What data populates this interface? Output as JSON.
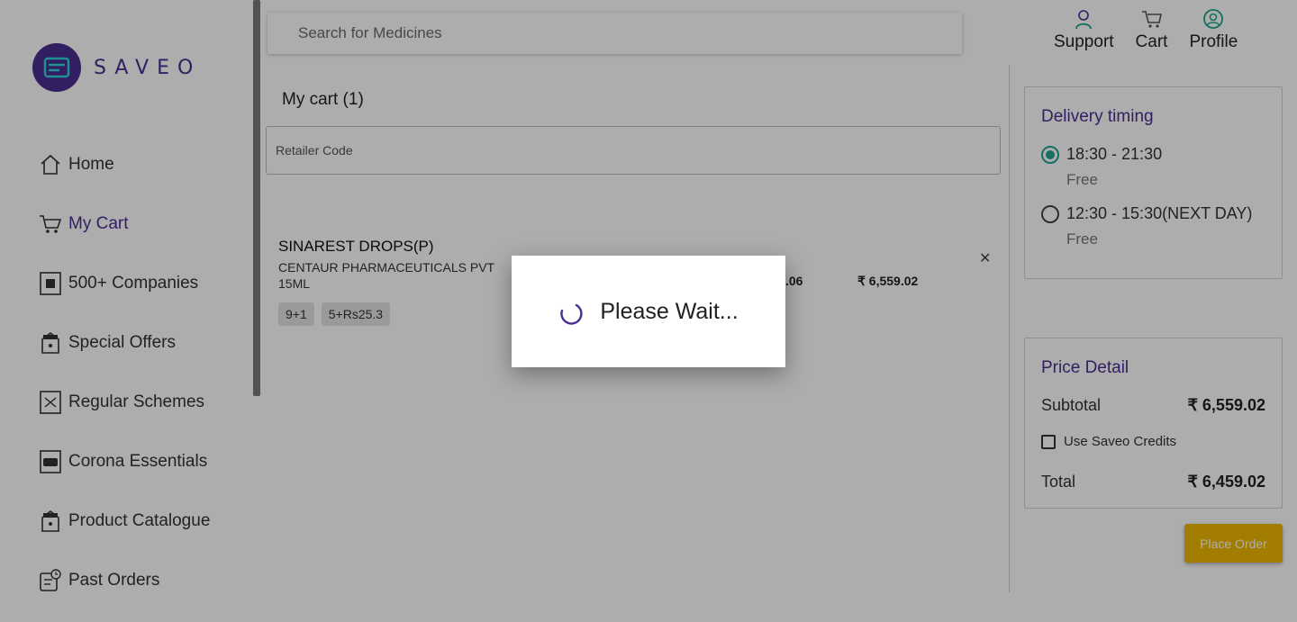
{
  "brand": {
    "name": "SAVEO",
    "color": "#4a2e8f"
  },
  "sidebar": {
    "items": [
      {
        "label": "Home",
        "icon": "home-icon"
      },
      {
        "label": "My Cart",
        "icon": "cart-icon",
        "active": true
      },
      {
        "label": "500+ Companies",
        "icon": "companies-icon"
      },
      {
        "label": "Special Offers",
        "icon": "offers-tag-icon"
      },
      {
        "label": "Regular Schemes",
        "icon": "schemes-icon"
      },
      {
        "label": "Corona Essentials",
        "icon": "mask-icon"
      },
      {
        "label": "Product Catalogue",
        "icon": "catalogue-tag-icon"
      },
      {
        "label": "Past Orders",
        "icon": "past-orders-icon"
      }
    ]
  },
  "search": {
    "placeholder": "Search for Medicines"
  },
  "header_actions": [
    {
      "label": "Support",
      "icon": "support-agent-icon"
    },
    {
      "label": "Cart",
      "icon": "cart-icon"
    },
    {
      "label": "Profile",
      "icon": "profile-icon"
    }
  ],
  "cart": {
    "title": "My cart (1)",
    "retailer_placeholder": "Retailer Code",
    "items": [
      {
        "name": "SINAREST DROPS(P)",
        "manufacturer": "CENTAUR PHARMACEUTICALS PVT",
        "pack": "15ML",
        "schemes": [
          "9+1",
          "5+Rs25.3"
        ],
        "price_partial": ".06",
        "total": "₹ 6,559.02"
      }
    ]
  },
  "delivery": {
    "title": "Delivery timing",
    "slots": [
      {
        "time": "18:30 - 21:30",
        "fee": "Free",
        "selected": true
      },
      {
        "time": "12:30 - 15:30(NEXT DAY)",
        "fee": "Free",
        "selected": false
      }
    ]
  },
  "price_detail": {
    "title": "Price Detail",
    "subtotal_label": "Subtotal",
    "subtotal_value": "₹ 6,559.02",
    "credits_label": "Use Saveo Credits",
    "total_label": "Total",
    "total_value": "₹ 6,459.02"
  },
  "place_order_label": "Place Order",
  "loading": {
    "message": "Please Wait..."
  },
  "colors": {
    "accent": "#4a2e8f",
    "radio": "#1ea58f",
    "button": "#f0b800"
  }
}
